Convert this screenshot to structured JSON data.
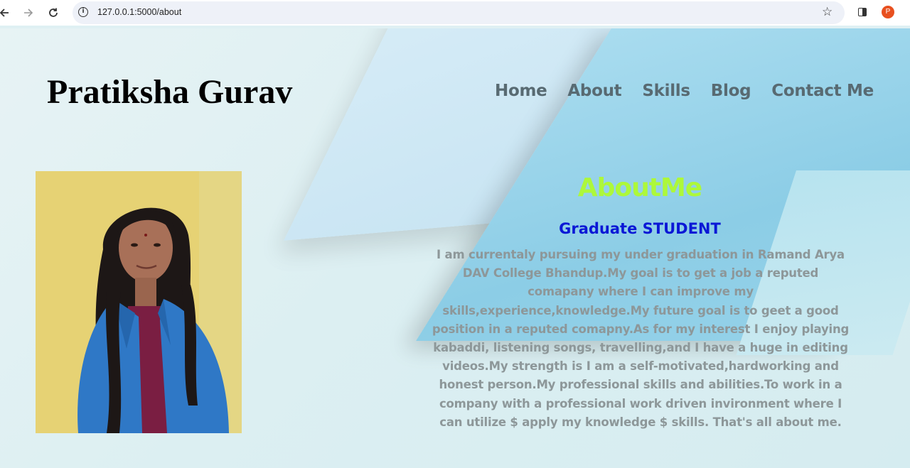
{
  "browser": {
    "url": "127.0.0.1:5000/about",
    "back_icon": "arrow-left-icon",
    "forward_icon": "arrow-right-icon",
    "reload_icon": "reload-icon",
    "info_icon": "info-icon",
    "bookmark_icon": "star-icon",
    "panel_icon": "side-panel-icon",
    "profile_initial": "P",
    "profile_color": "#e8501f"
  },
  "header": {
    "site_name": "Pratiksha Gurav",
    "nav": [
      "Home",
      "About",
      "Skills",
      "Blog",
      "Contact Me"
    ]
  },
  "about": {
    "title": "AboutMe",
    "subtitle": "Graduate STUDENT",
    "body": "I am currentaly pursuing my under graduation in Ramand Arya DAV College Bhandup.My goal is to get a job a reputed comapany where I can improve my skills,experience,knowledge.My future goal is to geet a good position in a reputed comapny.As for my interest I enjoy playing kabaddi, listening songs, travelling,and I have a huge in editing videos.My strength is I am a self-motivated,hardworking and honest person.My professional skills and abilities.To work in a company with a professional work driven invironment where I can utilize $ apply my knowledge $ skills. That's all about me."
  },
  "colors": {
    "title": "#adf83a",
    "subtitle": "#0b18d6",
    "body": "#8d9799",
    "nav": "#586a72"
  }
}
